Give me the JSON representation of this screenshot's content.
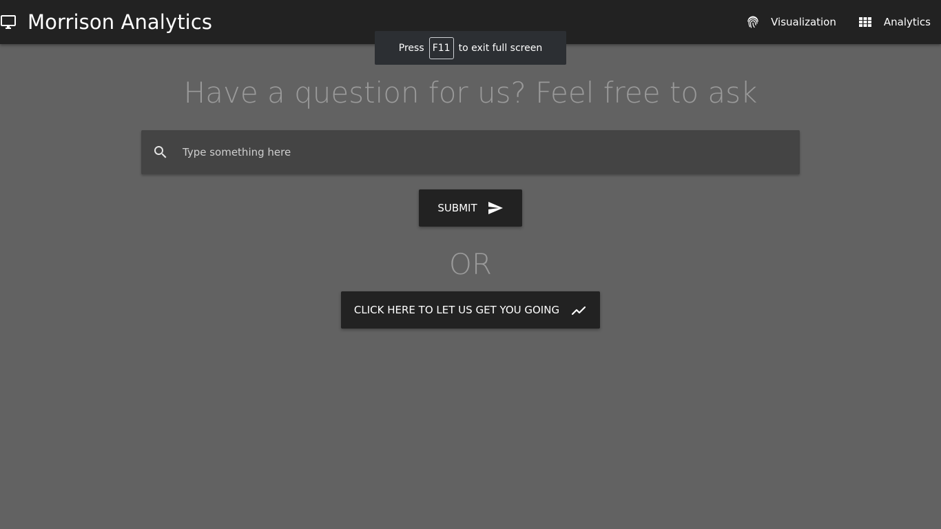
{
  "navbar": {
    "brand_icon": "desktop-monitor-icon",
    "brand_title": "Morrison Analytics",
    "links": [
      {
        "icon": "fingerprint-icon",
        "label": "Visualization"
      },
      {
        "icon": "grid-view-icon",
        "label": "Analytics"
      }
    ]
  },
  "fullscreen_notice": {
    "prefix": "Press",
    "key": "F11",
    "suffix": "to exit full screen"
  },
  "main": {
    "headline": "Have a question for us? Feel free to ask",
    "search": {
      "icon": "search-icon",
      "placeholder": "Type something here",
      "value": ""
    },
    "submit_button": {
      "label": "SUBMIT",
      "icon": "send-icon"
    },
    "or_text": "OR",
    "get_going_button": {
      "label": "CLICK HERE TO LET US GET YOU GOING",
      "icon": "trending-up-icon"
    }
  },
  "colors": {
    "navbar_bg": "#222222",
    "page_bg": "#626262",
    "search_bg": "#444444",
    "button_bg": "#222222",
    "muted_text": "#9a9a9a"
  }
}
